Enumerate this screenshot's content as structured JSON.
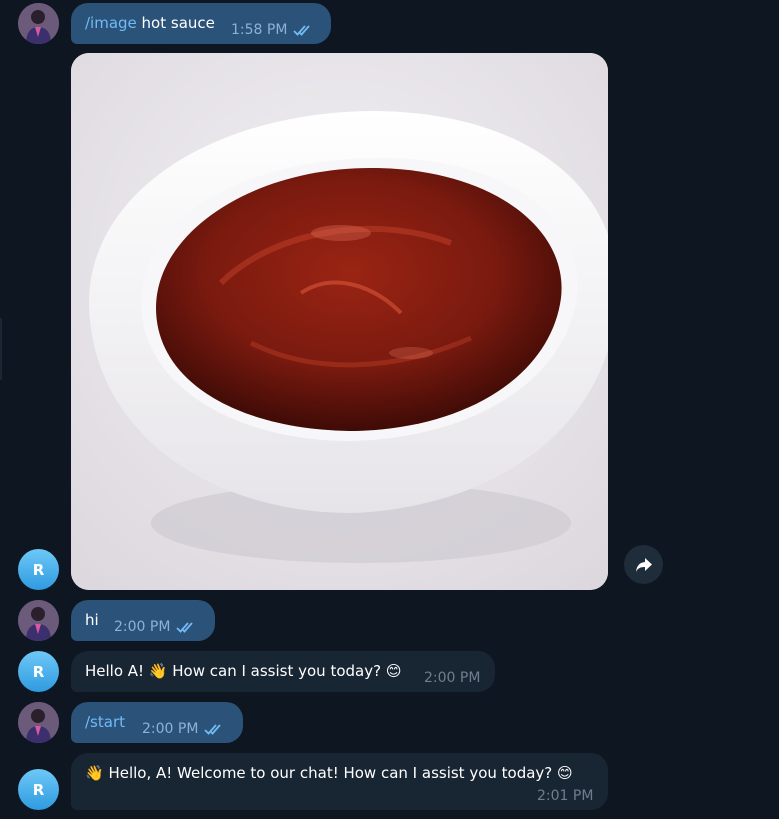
{
  "colors": {
    "background": "#0e1621",
    "outgoing_bubble": "#2b5278",
    "incoming_bubble": "#182533",
    "command_text": "#71baf5",
    "bot_avatar": "#3fa9eb",
    "read_checks": "#71baf5"
  },
  "messages": [
    {
      "side": "outgoing",
      "command": "/image",
      "text": " hot sauce",
      "time": "1:58 PM",
      "status": "read"
    },
    {
      "side": "incoming",
      "type": "image",
      "image_subject": "red sauce in white bowl",
      "action_icon": "forward-arrow-icon"
    },
    {
      "side": "outgoing",
      "text": "hi",
      "time": "2:00 PM",
      "status": "read"
    },
    {
      "side": "incoming",
      "text": "Hello A! 👋 How can I assist you today? 😊",
      "time": "2:00 PM"
    },
    {
      "side": "outgoing",
      "command": "/start",
      "time": "2:00 PM",
      "status": "read"
    },
    {
      "side": "incoming",
      "text": "👋 Hello, A! Welcome to our chat! How can I assist you today? 😊",
      "time": "2:01 PM"
    }
  ],
  "avatars": {
    "bot_initial": "R",
    "user_icon": "user-photo-avatar"
  }
}
